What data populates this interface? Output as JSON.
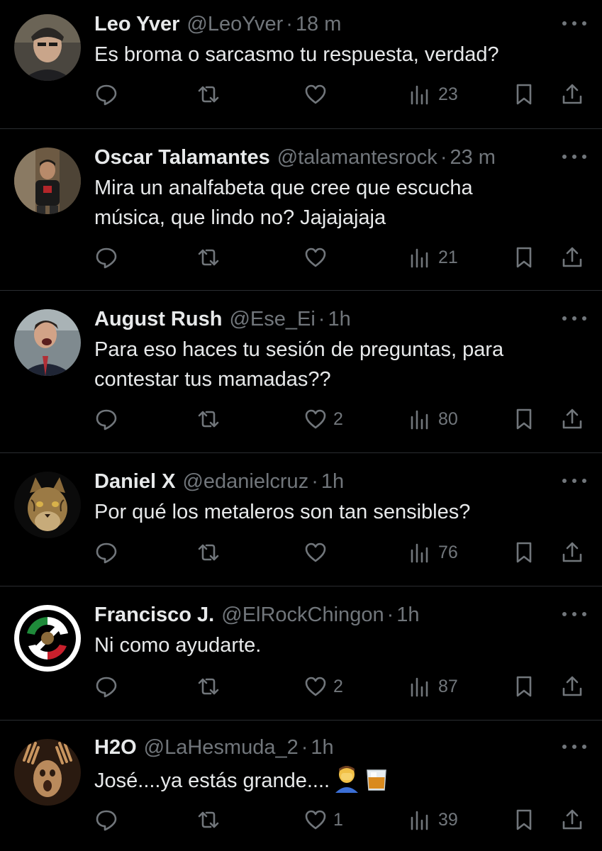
{
  "tweets": [
    {
      "name": "Leo Yver",
      "handle": "@LeoYver",
      "time": "18 m",
      "text": "Es broma o sarcasmo tu respuesta, verdad?",
      "likes": "",
      "views": "23"
    },
    {
      "name": "Oscar Talamantes",
      "handle": "@talamantesrock",
      "time": "23 m",
      "text": "Mira un analfabeta que cree que escucha\nmúsica, que lindo no? Jajajajaja",
      "likes": "",
      "views": "21"
    },
    {
      "name": "August Rush",
      "handle": "@Ese_Ei",
      "time": "1h",
      "text": "Para eso haces tu sesión de preguntas, para\ncontestar tus mamadas??",
      "likes": "2",
      "views": "80"
    },
    {
      "name": "Daniel X",
      "handle": "@edanielcruz",
      "time": "1h",
      "text": "Por qué los metaleros son tan sensibles?",
      "likes": "",
      "views": "76"
    },
    {
      "name": "Francisco J.",
      "handle": "@ElRockChingon",
      "time": "1h",
      "text": "Ni como ayudarte.",
      "likes": "2",
      "views": "87"
    },
    {
      "name": "H2O",
      "handle": "@LaHesmuda_2",
      "time": "1h",
      "text": "José....ya estás grande....",
      "likes": "1",
      "views": "39",
      "emojis": [
        "facepalm-emoji",
        "whisky-glass-emoji"
      ]
    }
  ],
  "separator": "·",
  "colors": {
    "background": "#000000",
    "text": "#e7e9ea",
    "muted": "#71767b",
    "divider": "#2a2d31"
  }
}
